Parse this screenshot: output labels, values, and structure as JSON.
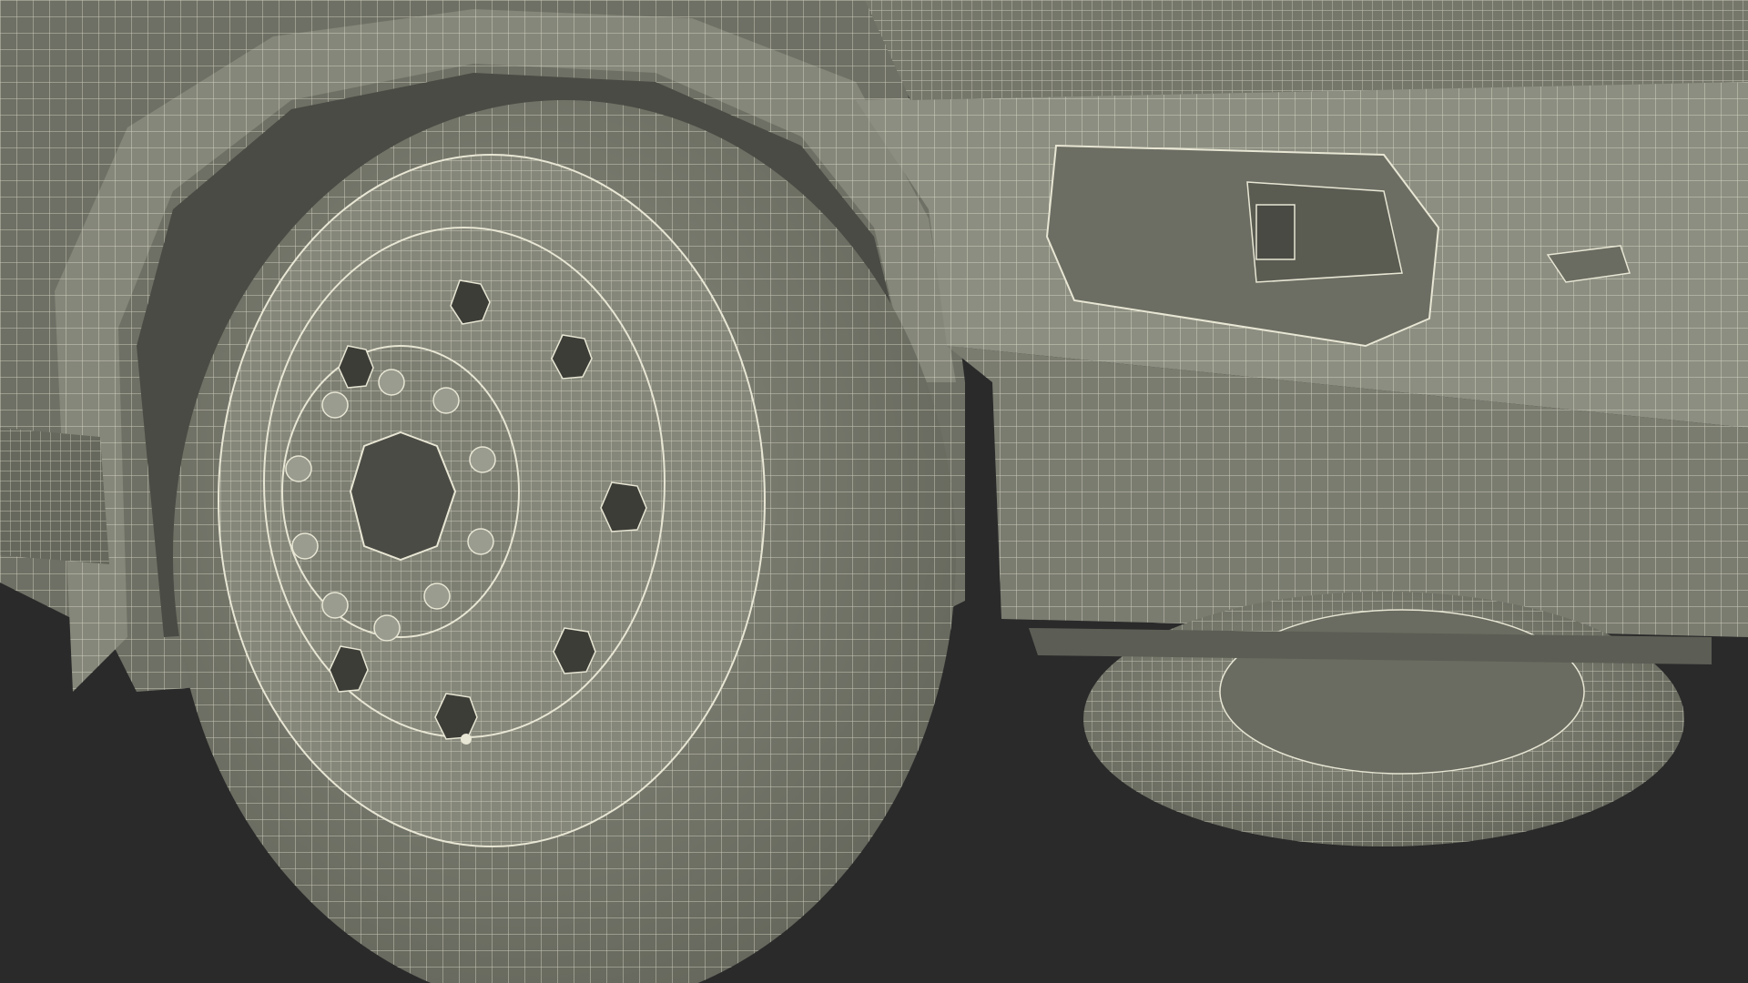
{
  "scene": {
    "subject": "wireframe-render-truck-front-wheels",
    "colors": {
      "background": "#2a2a2a",
      "surface": "#7a7c6f",
      "surface_light": "#8e9083",
      "surface_dark": "#5e6056",
      "shadow": "#3c3d37",
      "wire": "#e8e6d4"
    }
  }
}
